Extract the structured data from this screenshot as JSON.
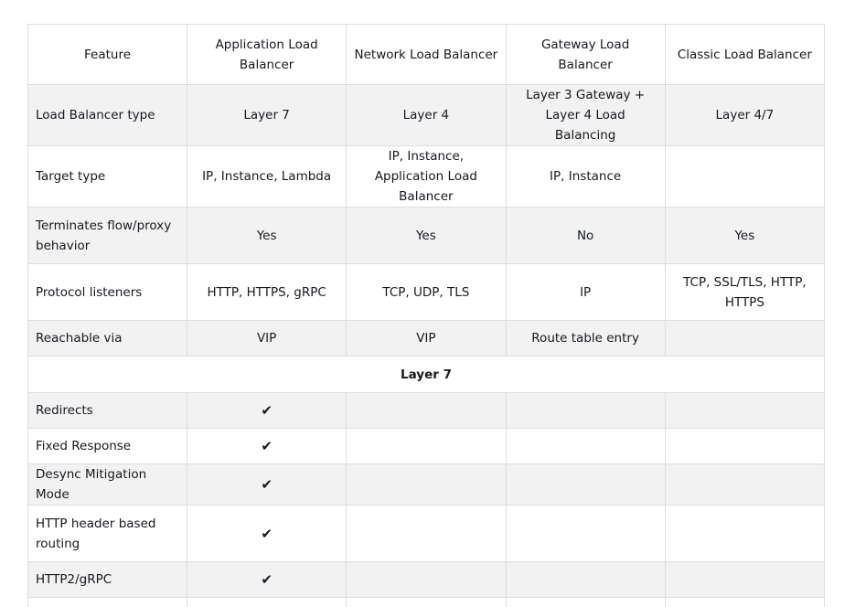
{
  "columns": [
    "Feature",
    "Application Load Balancer",
    "Network Load Balancer",
    "Gateway Load Balancer",
    "Classic Load Balancer"
  ],
  "rows": [
    {
      "feature": "Load Balancer type",
      "values": [
        "Layer 7",
        "Layer 4",
        "Layer 3 Gateway + Layer 4 Load Balancing",
        "Layer 4/7"
      ]
    },
    {
      "feature": "Target type",
      "values": [
        "IP, Instance, Lambda",
        "IP, Instance, Application Load Balancer",
        "IP, Instance",
        ""
      ]
    },
    {
      "feature": "Terminates flow/proxy behavior",
      "values": [
        "Yes",
        "Yes",
        "No",
        "Yes"
      ]
    },
    {
      "feature": "Protocol listeners",
      "values": [
        "HTTP, HTTPS, gRPC",
        "TCP, UDP, TLS",
        "IP",
        "TCP, SSL/TLS, HTTP, HTTPS"
      ]
    },
    {
      "feature": "Reachable via",
      "values": [
        "VIP",
        "VIP",
        "Route table entry",
        ""
      ]
    }
  ],
  "section": "Layer 7",
  "layer7_rows": [
    {
      "feature": "Redirects",
      "values": [
        "✔",
        "",
        "",
        ""
      ]
    },
    {
      "feature": "Fixed Response",
      "values": [
        "✔",
        "",
        "",
        ""
      ]
    },
    {
      "feature": "Desync Mitigation Mode",
      "values": [
        "✔",
        "",
        "",
        ""
      ]
    },
    {
      "feature": "HTTP header based routing",
      "values": [
        "✔",
        "",
        "",
        ""
      ]
    },
    {
      "feature": "HTTP2/gRPC",
      "values": [
        "✔",
        "",
        "",
        ""
      ]
    }
  ]
}
